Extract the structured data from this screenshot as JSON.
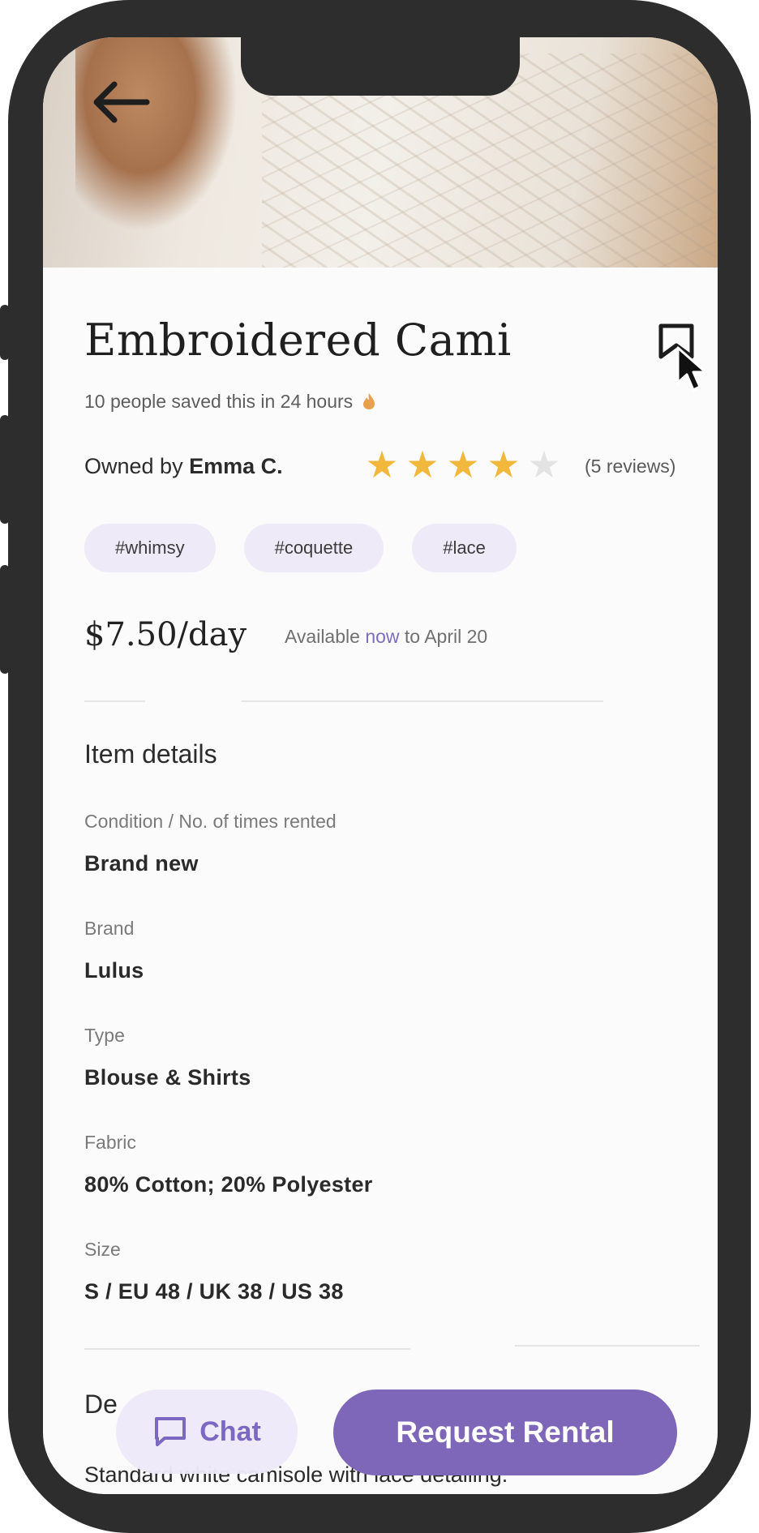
{
  "product": {
    "title": "Embroidered Cami",
    "saved_text": "10 people saved this in 24 hours",
    "owner_prefix": "Owned by",
    "owner_name": "Emma C.",
    "rating": 4,
    "rating_max": 5,
    "reviews": "(5 reviews)",
    "tags": [
      "#whimsy",
      "#coquette",
      "#lace"
    ],
    "price": "$7.50/day",
    "availability_prefix": "Available",
    "availability_now": "now",
    "availability_suffix": "to April 20"
  },
  "details": {
    "heading": "Item details",
    "items": [
      {
        "label": "Condition / No. of times rented",
        "value": "Brand new"
      },
      {
        "label": "Brand",
        "value": "Lulus"
      },
      {
        "label": "Type",
        "value": "Blouse & Shirts"
      },
      {
        "label": "Fabric",
        "value": "80% Cotton; 20% Polyester"
      },
      {
        "label": "Size",
        "value": "S / EU 48 / UK 38 / US 38"
      }
    ]
  },
  "description": {
    "heading": "De",
    "text": "Standard white camisole with lace detailing."
  },
  "actions": {
    "chat_label": "Chat",
    "request_label": "Request Rental"
  },
  "colors": {
    "accent": "#7e66b8",
    "tag_bg": "#eeeaf8",
    "star_filled": "#f1b83d",
    "star_empty": "#e3e3e3",
    "frame": "#2e2d2d"
  },
  "icons": {
    "back": "arrow-left-icon",
    "bookmark": "bookmark-icon",
    "fire": "fire-icon",
    "chat": "chat-bubble-icon",
    "cursor": "mouse-pointer-icon"
  }
}
